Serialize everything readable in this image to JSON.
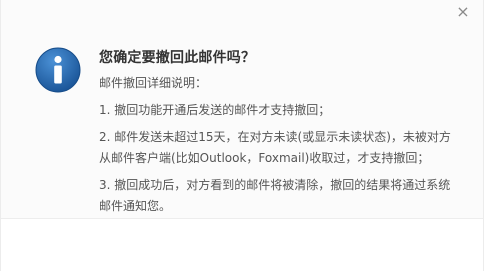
{
  "dialog": {
    "close_symbol": "×",
    "icon": "info-icon",
    "title": "您确定要撤回此邮件吗？",
    "details_heading": "邮件撤回详细说明：",
    "item1": "1. 撤回功能开通后发送的邮件才支持撤回；",
    "item2_line1": "2. 邮件发送未超过15天，在对方未读(或显示未读状态)，未被对方",
    "item2_line2": "从邮件客户端(比如Outlook，Foxmail)收取过，才支持撤回；",
    "item3_line1": "3. 撤回成功后，对方看到的邮件将被清除，撤回的结果将通过系统",
    "item3_line2": "邮件通知您。"
  },
  "colors": {
    "icon_blue": "#1f5fa6",
    "icon_blue_light": "#3f86cf"
  }
}
